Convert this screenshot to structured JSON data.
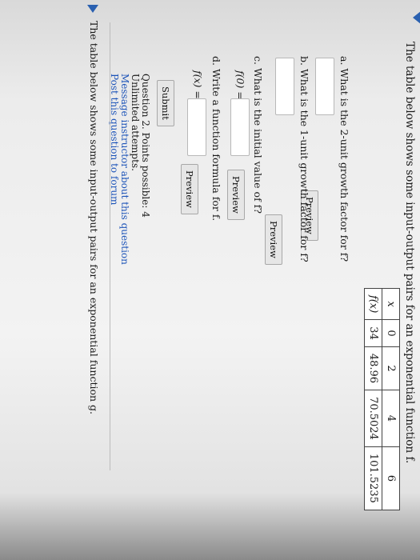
{
  "question": {
    "intro": "The table below shows some input-output pairs for an exponential function f.",
    "table": {
      "row_labels": [
        "x",
        "f(x)"
      ],
      "x": [
        "0",
        "2",
        "4",
        "6"
      ],
      "fx": [
        "34",
        "48.96",
        "70.5024",
        "101.5235"
      ]
    },
    "parts": {
      "a": "a.  What is the 2-unit growth factor for f?",
      "b": "b.  What is the 1-unit growth factor for f?",
      "c": "c.  What is the initial value of f?",
      "d": "d.  Write a function formula for f."
    },
    "f0_label": "f(0) =",
    "fx_label": "f(x) =",
    "preview_label": "Preview",
    "submit_label": "Submit",
    "answer_a": "",
    "answer_b": "",
    "answer_c": "",
    "answer_d": ""
  },
  "info": {
    "points": "Question 2. Points possible: 4",
    "attempts": "Unlimited attempts.",
    "message_link": "Message instructor about this question",
    "forum_link": "Post this question to forum"
  },
  "next_question": {
    "intro": "The table below shows some input-output pairs for an exponential function g."
  },
  "colors": {
    "link": "#1c53b8",
    "triangle": "#2a60b0"
  }
}
